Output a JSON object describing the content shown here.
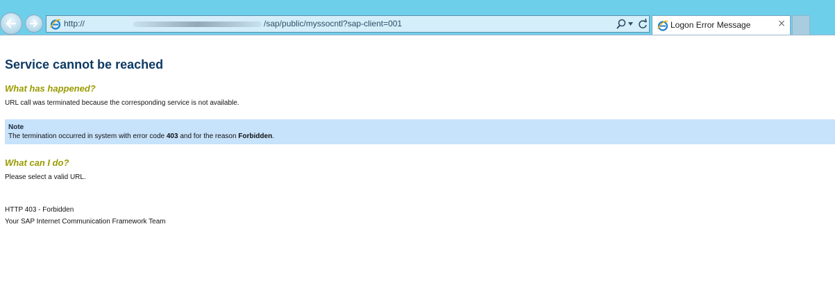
{
  "browser": {
    "url_prefix": "http://",
    "url_path": "/sap/public/myssocntl?sap-client=001",
    "tab_title": "Logon Error Message",
    "tab_close": "×"
  },
  "page": {
    "title": "Service cannot be reached",
    "what_happened_heading": "What has happened?",
    "what_happened_text": "URL call was terminated because the corresponding service is not available.",
    "note": {
      "title": "Note",
      "text_before_code": "The termination occurred in system with error code ",
      "error_code": "403",
      "text_middle": " and for the reason ",
      "reason": "Forbidden",
      "text_end": "."
    },
    "what_can_i_do_heading": "What can I do?",
    "what_can_i_do_text": "Please select a valid URL.",
    "http_status": "HTTP 403 - Forbidden",
    "team_signature": "Your SAP Internet Communication Framework Team"
  },
  "colors": {
    "chrome": "#6ecfeb",
    "title": "#0e3a63",
    "section_heading": "#9a9a00",
    "note_background": "#c7e2fb"
  },
  "icons": [
    "back-arrow-icon",
    "forward-arrow-icon",
    "ie-logo-icon",
    "search-icon",
    "dropdown-icon",
    "refresh-icon",
    "close-icon"
  ]
}
